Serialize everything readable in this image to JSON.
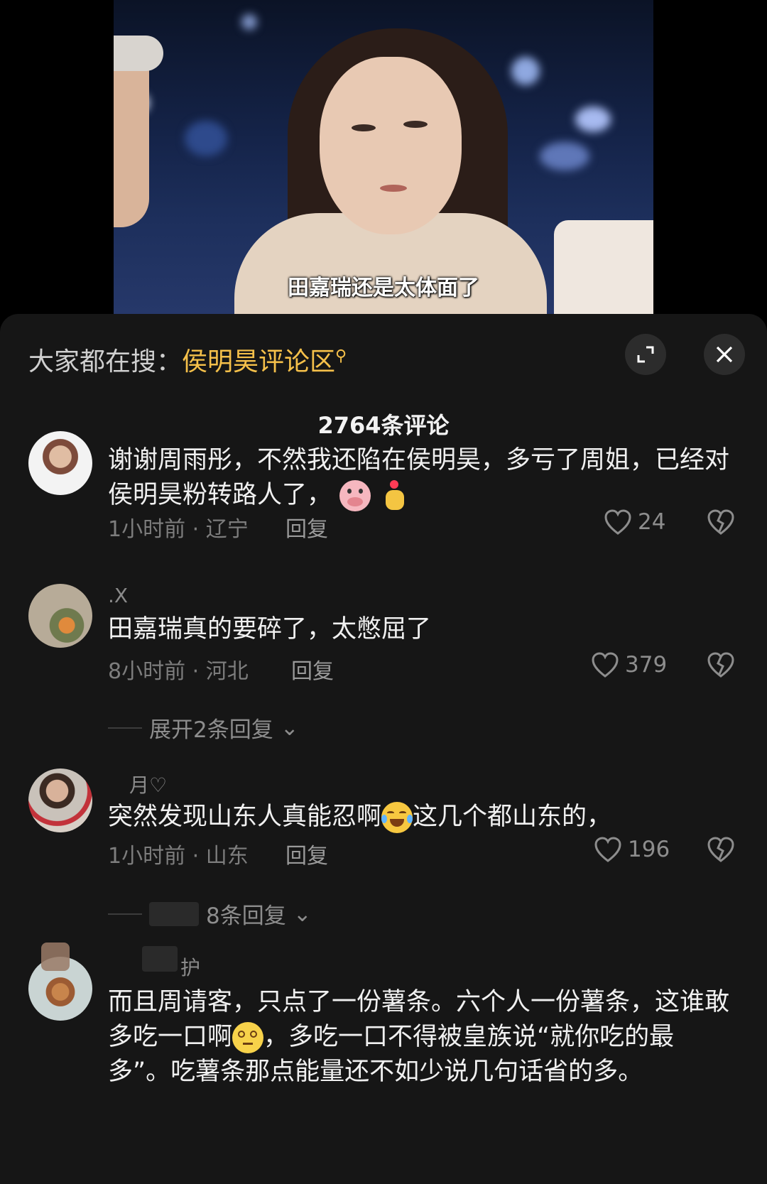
{
  "video": {
    "subtitle": "田嘉瑞还是太体面了"
  },
  "sheet": {
    "search_prefix": "大家都在搜：",
    "search_term": "侯明昊评论区",
    "comment_count": "2764条评论"
  },
  "comments": [
    {
      "user": "",
      "text": "谢谢周雨彤，不然我还陷在侯明昊，多亏了周姐，已经对侯明昊粉转路人了，",
      "time_location": "1小时前 · 辽宁",
      "reply_label": "回复",
      "likes": "24"
    },
    {
      "user": ".X",
      "text": "田嘉瑞真的要碎了，太憋屈了",
      "time_location": "8小时前 · 河北",
      "reply_label": "回复",
      "likes": "379",
      "expand_label": "展开2条回复"
    },
    {
      "user": "月♡",
      "text_a": "突然发现山东人真能忍啊",
      "text_b": "这几个都山东的，",
      "time_location": "1小时前 · 山东",
      "reply_label": "回复",
      "likes": "196",
      "expand_label": "8条回复"
    },
    {
      "user": "护",
      "text_a": "而且周请客，只点了一份薯条。六个人一份薯条，这谁敢多吃一口啊",
      "text_b": "，多吃一口不得被皇族说“就你吃的最多”。吃薯条那点能量还不如少说几句话省的多。"
    }
  ],
  "colors": {
    "accent": "#f5c04a",
    "sheet_bg": "#161616",
    "text_primary": "#f0f0f0",
    "text_secondary": "#7d7d7d"
  }
}
